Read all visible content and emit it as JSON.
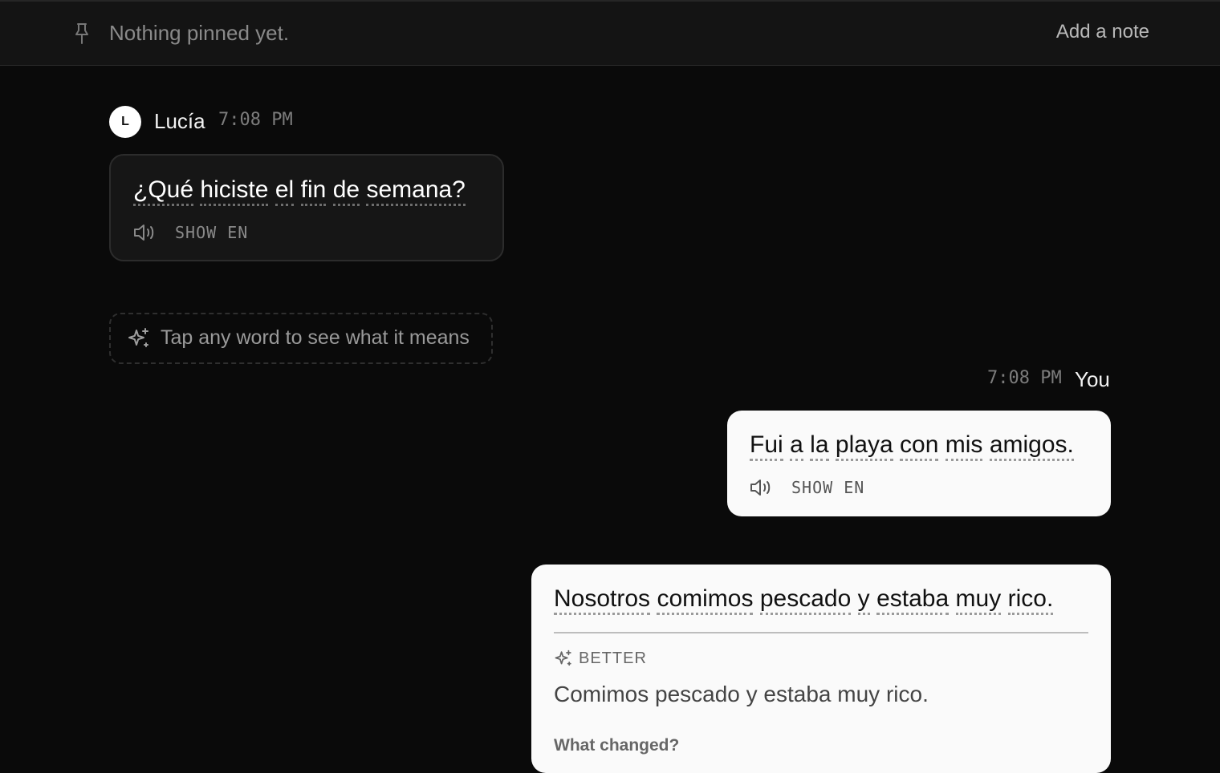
{
  "pinned": {
    "empty_text": "Nothing pinned yet.",
    "add_note_label": "Add a note"
  },
  "messages": [
    {
      "sender": "Lucía",
      "avatar_initial": "L",
      "time": "7:08 PM",
      "words": [
        "¿Qué",
        "hiciste",
        "el",
        "fin",
        "de",
        "semana?"
      ],
      "show_en_label": "SHOW EN"
    },
    {
      "sender": "You",
      "time": "7:08 PM",
      "words": [
        "Fui",
        "a",
        "la",
        "playa",
        "con",
        "mis",
        "amigos."
      ],
      "show_en_label": "SHOW EN"
    }
  ],
  "hint": {
    "text": "Tap any word to see what it means"
  },
  "correction": {
    "words": [
      "Nosotros",
      "comimos",
      "pescado",
      "y",
      "estaba",
      "muy",
      "rico."
    ],
    "better_label": "BETTER",
    "better_text": "Comimos pescado y estaba muy rico.",
    "what_changed_label": "What changed?"
  }
}
